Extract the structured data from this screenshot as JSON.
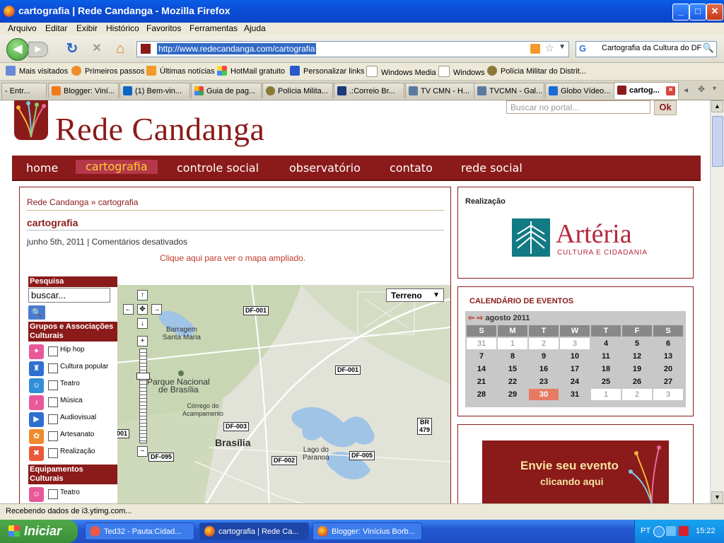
{
  "window": {
    "title": "cartografia | Rede Candanga - Mozilla Firefox",
    "controls": {
      "minimize": "_",
      "maximize": "□",
      "close": "✕"
    }
  },
  "menubar": [
    "Arquivo",
    "Editar",
    "Exibir",
    "Histórico",
    "Favoritos",
    "Ferramentas",
    "Ajuda"
  ],
  "navbar": {
    "url": "http://www.redecandanga.com/cartografia",
    "search_text": "Cartografia da Cultura do DF",
    "search_engine_label": "G",
    "icons": {
      "back": "◀",
      "forward": "▶",
      "reload": "↻",
      "stop": "✕",
      "home": "⌂",
      "star": "☆",
      "search": "🔍"
    }
  },
  "bookmarks": [
    "Mais visitados",
    "Primeiros passos",
    "Últimas notícias",
    "HotMail gratuito",
    "Personalizar links",
    "Windows Media",
    "Windows",
    "Polícia Militar do Distrit..."
  ],
  "tabs": [
    {
      "label": "- Entr...",
      "color": "#3a6fd8"
    },
    {
      "label": "Blogger: Viní...",
      "color": "#f07a1a"
    },
    {
      "label": "(1) Bem-vin...",
      "color": "#0a66c2"
    },
    {
      "label": "Guia de pag...",
      "color": "#4285f4"
    },
    {
      "label": "Polícia Milita...",
      "color": "#8a7a3a"
    },
    {
      "label": ".:Correio Br...",
      "color": "#1a3a7a"
    },
    {
      "label": "TV CMN - H...",
      "color": "#5a7aa0"
    },
    {
      "label": "TVCMN - Gal...",
      "color": "#5a7aa0"
    },
    {
      "label": "Globo Vídeo...",
      "color": "#1a6ad8"
    },
    {
      "label": "cartog...",
      "color": "#8b1a1a",
      "active": true
    }
  ],
  "tab_close": "×",
  "tab_scroll": "▸",
  "site": {
    "logo": "Rede Candanga",
    "search_placeholder": "Buscar no portal...",
    "search_button": "Ok",
    "nav": [
      "home",
      "cartografia",
      "controle social",
      "observatório",
      "contato",
      "rede social"
    ],
    "nav_selected": 1,
    "breadcrumb": "Rede Candanga » cartografia",
    "page_title": "cartografia",
    "meta": "junho 5th, 2011 | Comentários desativados",
    "map_link": "Clique aqui para ver o mapa ampliado."
  },
  "filter": {
    "search_title": "Pesquisa",
    "search_value": "buscar...",
    "group1_title": "Grupos e Associações Culturais",
    "group1_items": [
      {
        "label": "Hip hop",
        "icon": "hiphop-icon",
        "color": "#e8589a",
        "glyph": "✦"
      },
      {
        "label": "Cultura popular",
        "icon": "cultura-popular-icon",
        "color": "#2f6fd0",
        "glyph": "♜"
      },
      {
        "label": "Teatro",
        "icon": "theatre-masks-icon",
        "color": "#2f8fd8",
        "glyph": "☺"
      },
      {
        "label": "Música",
        "icon": "music-icon",
        "color": "#e8589a",
        "glyph": "♪"
      },
      {
        "label": "Audiovisual",
        "icon": "camera-icon",
        "color": "#2f6fd0",
        "glyph": "▶"
      },
      {
        "label": "Artesanato",
        "icon": "crafts-icon",
        "color": "#f08a2a",
        "glyph": "✿"
      },
      {
        "label": "Realização",
        "icon": "tools-icon",
        "color": "#e85a3a",
        "glyph": "✖"
      }
    ],
    "group2_title": "Equipamentos Culturais",
    "group2_items": [
      {
        "label": "Teatro",
        "icon": "theatre-masks-icon",
        "color": "#e8589a",
        "glyph": "☺"
      }
    ]
  },
  "map": {
    "type_selector": "Terreno",
    "labels": [
      {
        "text": "Barragem\nSanta Maria"
      },
      {
        "text": "Parque Nacional\nde Brasília"
      },
      {
        "text": "Córrego do\nAcampamento"
      },
      {
        "text": "Brasília"
      },
      {
        "text": "Lago do\nParanoá"
      }
    ],
    "shields": [
      "DF-001",
      "DF-001",
      "DF-003",
      "DF-095",
      "DF-002",
      "DF-005",
      "BR\n479",
      "001"
    ],
    "controls": {
      "up": "↑",
      "left": "←",
      "center": "✥",
      "right": "→",
      "down": "↓",
      "zoom_in": "+",
      "zoom_out": "−"
    }
  },
  "sidebar": {
    "realizacao_title": "Realização",
    "arteria_name": "Artéria",
    "arteria_sub": "CULTURA E CIDADANIA",
    "calendar_title": "CALENDÁRIO DE EVENTOS",
    "calendar_month": "agosto 2011",
    "calendar_arrows": [
      "⇦",
      "⇨"
    ],
    "weekdays": [
      "S",
      "M",
      "T",
      "W",
      "T",
      "F",
      "S"
    ],
    "weeks": [
      [
        {
          "d": "31",
          "out": true
        },
        {
          "d": "1",
          "out": true
        },
        {
          "d": "2",
          "out": true
        },
        {
          "d": "3",
          "out": true
        },
        {
          "d": "4"
        },
        {
          "d": "5"
        },
        {
          "d": "6"
        }
      ],
      [
        {
          "d": "7"
        },
        {
          "d": "8"
        },
        {
          "d": "9"
        },
        {
          "d": "10"
        },
        {
          "d": "11"
        },
        {
          "d": "12"
        },
        {
          "d": "13"
        }
      ],
      [
        {
          "d": "14"
        },
        {
          "d": "15"
        },
        {
          "d": "16"
        },
        {
          "d": "17"
        },
        {
          "d": "18"
        },
        {
          "d": "19"
        },
        {
          "d": "20"
        }
      ],
      [
        {
          "d": "21"
        },
        {
          "d": "22"
        },
        {
          "d": "23"
        },
        {
          "d": "24"
        },
        {
          "d": "25"
        },
        {
          "d": "26"
        },
        {
          "d": "27"
        }
      ],
      [
        {
          "d": "28"
        },
        {
          "d": "29"
        },
        {
          "d": "30",
          "today": true
        },
        {
          "d": "31"
        },
        {
          "d": "1",
          "out": true
        },
        {
          "d": "2",
          "out": true
        },
        {
          "d": "3",
          "out": true
        }
      ]
    ],
    "banner_line1": "Envie seu evento",
    "banner_line2": "clicando aqui"
  },
  "status": "Recebendo dados de i3.ytimg.com...",
  "taskbar": {
    "start": "Iniciar",
    "buttons": [
      {
        "label": "Ted32 - Pauta:Cidad...",
        "color": "#e85a4a"
      },
      {
        "label": "cartografia | Rede Ca...",
        "color": "#f08a2a",
        "active": true
      },
      {
        "label": "Blogger: Vinícius Borb...",
        "color": "#f08a2a"
      }
    ],
    "lang": "PT",
    "clock": "15:22"
  }
}
